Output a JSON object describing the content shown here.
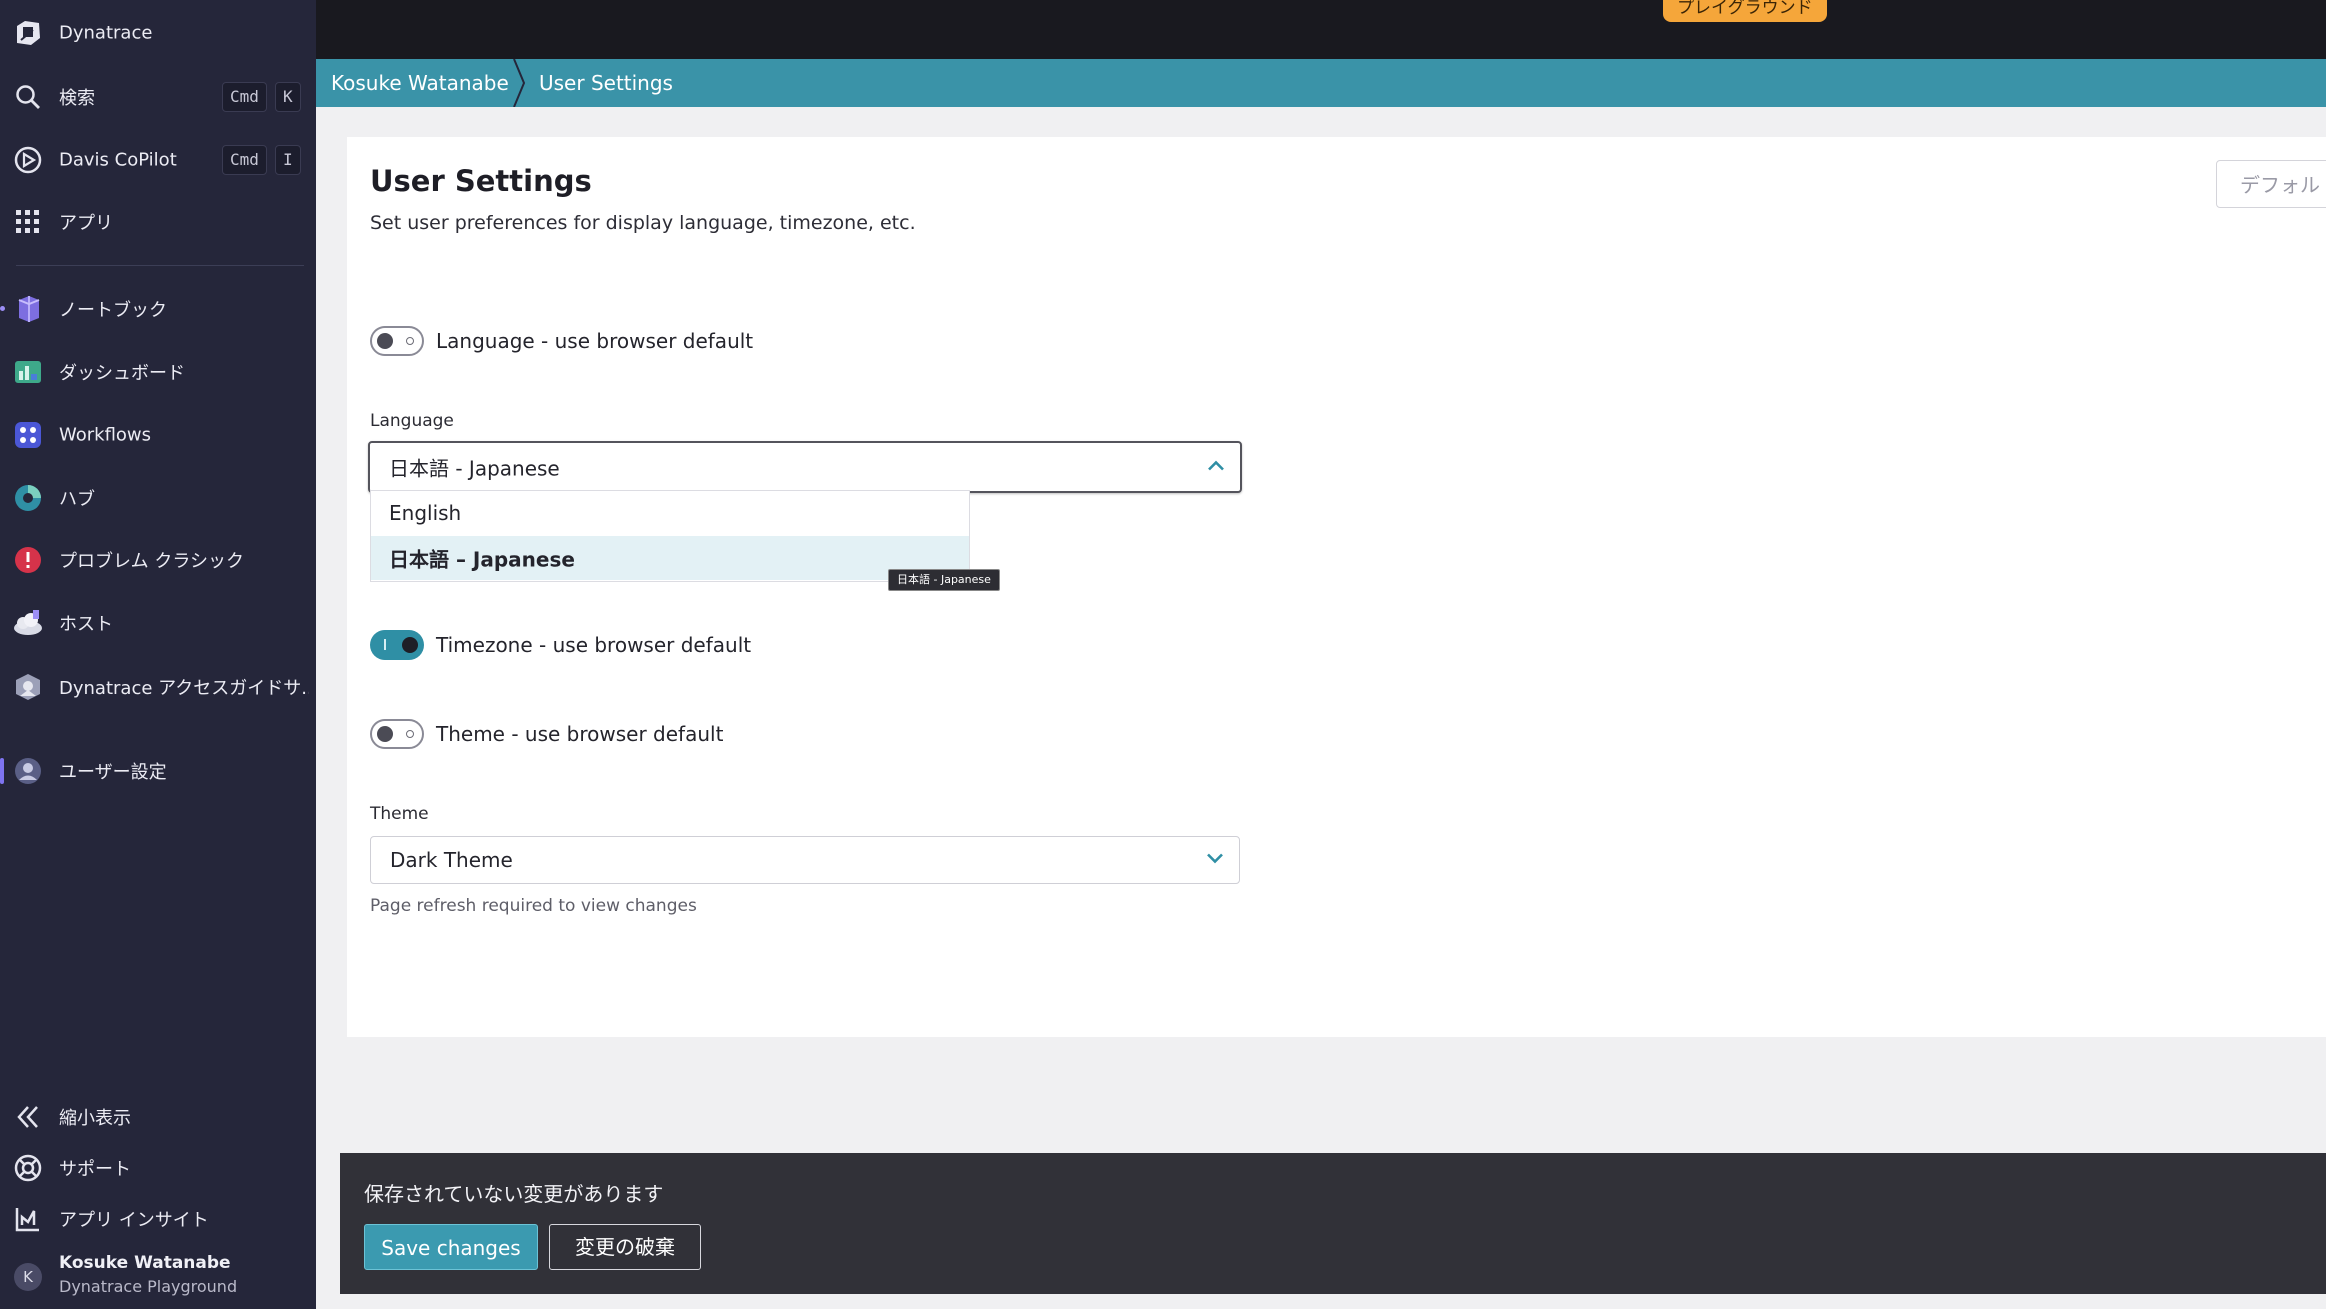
{
  "sidebar": {
    "brand": "Dynatrace",
    "search": {
      "label": "検索",
      "key1": "Cmd",
      "key2": "K"
    },
    "copilot": {
      "label": "Davis CoPilot",
      "key1": "Cmd",
      "key2": "I"
    },
    "apps": "アプリ",
    "items": [
      {
        "label": "ノートブック",
        "icon": "notebook-icon"
      },
      {
        "label": "ダッシュボード",
        "icon": "dashboard-icon"
      },
      {
        "label": "Workflows",
        "icon": "workflows-icon"
      },
      {
        "label": "ハブ",
        "icon": "hub-icon"
      },
      {
        "label": "プロブレム クラシック",
        "icon": "problem-icon"
      },
      {
        "label": "ホスト",
        "icon": "host-icon"
      },
      {
        "label": "Dynatrace アクセスガイドサ...",
        "icon": "access-guide-icon"
      },
      {
        "label": "ユーザー設定",
        "icon": "user-settings-icon"
      }
    ],
    "collapse": "縮小表示",
    "support": "サポート",
    "insights": "アプリ インサイト",
    "user": {
      "initial": "K",
      "name": "Kosuke Watanabe",
      "environment": "Dynatrace Playground"
    }
  },
  "topbar": {
    "badge": "プレイグラウンド"
  },
  "breadcrumb": {
    "root": "Kosuke Watanabe",
    "current": "User Settings"
  },
  "page": {
    "title": "User Settings",
    "subtitle": "Set user preferences for display language, timezone, etc.",
    "defaults_button": "デフォル"
  },
  "settings": {
    "language_toggle": {
      "label": "Language - use browser default",
      "on": false
    },
    "language_field": {
      "label": "Language",
      "value": "日本語 - Japanese",
      "options": [
        "English",
        "日本語 – Japanese"
      ],
      "selected_index": 1,
      "tooltip": "日本語 - Japanese"
    },
    "timezone_toggle": {
      "label": "Timezone - use browser default",
      "on": true
    },
    "theme_toggle": {
      "label": "Theme - use browser default",
      "on": false
    },
    "theme_field": {
      "label": "Theme",
      "value": "Dark Theme",
      "hint": "Page refresh required to view changes"
    }
  },
  "savebar": {
    "message": "保存されていない変更があります",
    "save": "Save changes",
    "discard": "変更の破棄"
  },
  "colors": {
    "sidebar": "#25263a",
    "accent": "#3a93a8",
    "badge": "#f5a63a"
  }
}
